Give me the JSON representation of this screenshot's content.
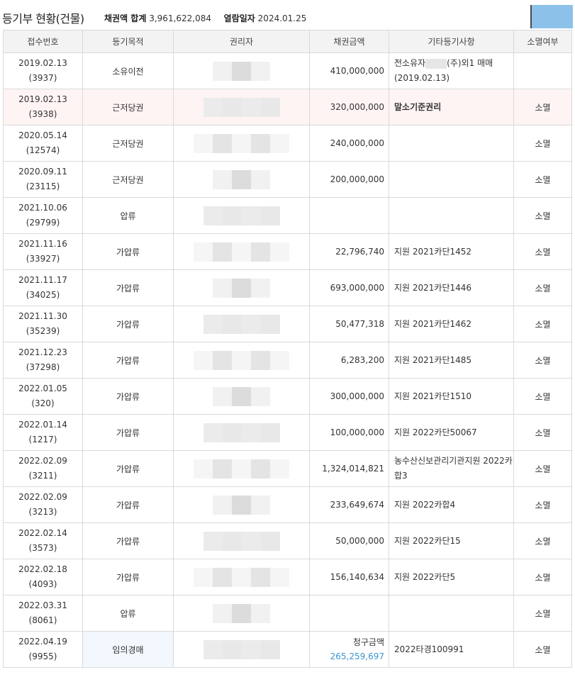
{
  "header": {
    "title": "등기부 현황(건물)",
    "total_label": "채권액 합계",
    "total_value": "3,961,622,084",
    "date_label": "열람일자",
    "date_value": "2024.01.25"
  },
  "table": {
    "columns": [
      "접수번호",
      "등기목적",
      "권리자",
      "채권금액",
      "기타등기사항",
      "소멸여부"
    ],
    "rows": [
      {
        "date": "2019.02.13",
        "no": "(3937)",
        "purpose": "소유이전",
        "amount": "410,000,000",
        "etc_prefix": "전소유자",
        "etc": "(주)외1 매매(2019.02.13)",
        "status": ""
      },
      {
        "date": "2019.02.13",
        "no": "(3938)",
        "purpose": "근저당권",
        "amount": "320,000,000",
        "etc": "말소기준권리",
        "status": "소멸"
      },
      {
        "date": "2020.05.14",
        "no": "(12574)",
        "purpose": "근저당권",
        "amount": "240,000,000",
        "etc": "",
        "status": "소멸"
      },
      {
        "date": "2020.09.11",
        "no": "(23115)",
        "purpose": "근저당권",
        "amount": "200,000,000",
        "etc": "",
        "status": "소멸"
      },
      {
        "date": "2021.10.06",
        "no": "(29799)",
        "purpose": "압류",
        "amount": "",
        "etc": "",
        "status": "소멸"
      },
      {
        "date": "2021.11.16",
        "no": "(33927)",
        "purpose": "가압류",
        "amount": "22,796,740",
        "etc": "지원 2021카단1452",
        "status": "소멸"
      },
      {
        "date": "2021.11.17",
        "no": "(34025)",
        "purpose": "가압류",
        "amount": "693,000,000",
        "etc": "지원 2021카단1446",
        "status": "소멸"
      },
      {
        "date": "2021.11.30",
        "no": "(35239)",
        "purpose": "가압류",
        "amount": "50,477,318",
        "etc": "지원 2021카단1462",
        "status": "소멸"
      },
      {
        "date": "2021.12.23",
        "no": "(37298)",
        "purpose": "가압류",
        "amount": "6,283,200",
        "etc": "지원 2021카단1485",
        "status": "소멸"
      },
      {
        "date": "2022.01.05",
        "no": "(320)",
        "purpose": "가압류",
        "amount": "300,000,000",
        "etc": "지원 2021카단1510",
        "status": "소멸"
      },
      {
        "date": "2022.01.14",
        "no": "(1217)",
        "purpose": "가압류",
        "amount": "100,000,000",
        "etc": "지원 2022카단50067",
        "status": "소멸"
      },
      {
        "date": "2022.02.09",
        "no": "(3211)",
        "purpose": "가압류",
        "amount": "1,324,014,821",
        "etc": "농수산신보관리기관지원 2022카합3",
        "status": "소멸"
      },
      {
        "date": "2022.02.09",
        "no": "(3213)",
        "purpose": "가압류",
        "amount": "233,649,674",
        "etc": "지원 2022카합4",
        "status": "소멸"
      },
      {
        "date": "2022.02.14",
        "no": "(3573)",
        "purpose": "가압류",
        "amount": "50,000,000",
        "etc": "지원 2022카단15",
        "status": "소멸"
      },
      {
        "date": "2022.02.18",
        "no": "(4093)",
        "purpose": "가압류",
        "amount": "156,140,634",
        "etc": "지원 2022카단5",
        "status": "소멸"
      },
      {
        "date": "2022.03.31",
        "no": "(8061)",
        "purpose": "압류",
        "amount": "",
        "etc": "",
        "status": "소멸"
      },
      {
        "date": "2022.04.19",
        "no": "(9955)",
        "purpose": "임의경매",
        "amount_label": "청구금액",
        "amount": "265,259,697",
        "etc": "2022타경100991",
        "status": "소멸"
      }
    ]
  }
}
